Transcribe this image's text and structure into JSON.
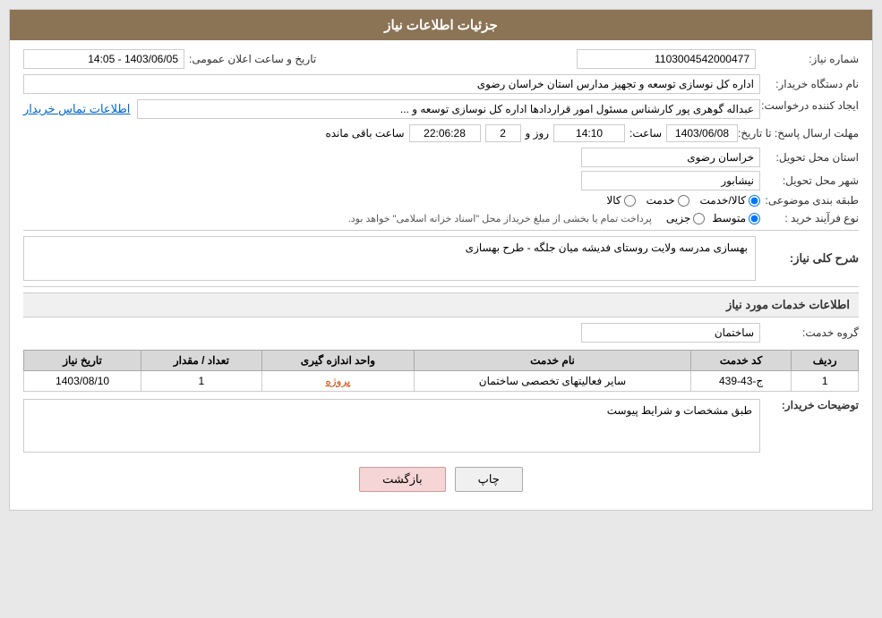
{
  "header": {
    "title": "جزئیات اطلاعات نیاز"
  },
  "fields": {
    "shomar_niaz_label": "شماره نیاز:",
    "shomar_niaz_value": "1103004542000477",
    "tarikh_label": "تاریخ و ساعت اعلان عمومی:",
    "tarikh_value": "1403/06/05 - 14:05",
    "nam_dastgah_label": "نام دستگاه خریدار:",
    "nam_dastgah_value": "اداره کل نوسازی  توسعه و تجهیز مدارس استان خراسان رضوی",
    "ejad_label": "ایجاد کننده درخواست:",
    "ejad_value": "عبداله گوهری پور کارشناس مسئول امور قراردادها  اداره کل نوسازی  توسعه و ...",
    "ejad_link": "اطلاعات تماس خریدار",
    "mohlat_label": "مهلت ارسال پاسخ: تا تاریخ:",
    "mohlat_date": "1403/06/08",
    "mohlat_saat_label": "ساعت:",
    "mohlat_saat_value": "14:10",
    "mohlat_roz_label": "روز و",
    "mohlat_roz_value": "2",
    "mohlat_countdown": "22:06:28",
    "mohlat_mande": "ساعت باقی مانده",
    "ostan_label": "استان محل تحویل:",
    "ostan_value": "خراسان رضوی",
    "shahr_label": "شهر محل تحویل:",
    "shahr_value": "نیشابور",
    "tabagheh_label": "طبقه بندی موضوعی:",
    "tabagheh_kala": "کالا",
    "tabagheh_khadamat": "خدمت",
    "tabagheh_kala_khadamat": "کالا/خدمت",
    "tabagheh_selected": "kala_khadamat",
    "noe_farayand_label": "نوع فرآیند خرید :",
    "noe_jozei": "جزیی",
    "noe_mottasat": "متوسط",
    "noe_desc": "پرداخت تمام یا بخشی از مبلغ خریداز محل \"اسناد خزانه اسلامی\" خواهد بود.",
    "noe_selected": "mottasat",
    "sharh_section_title": "شرح کلی نیاز:",
    "sharh_value": "بهسازی مدرسه ولایت روستای فدیشه میان جلگه - طرح بهسازی",
    "khadamat_section_title": "اطلاعات خدمات مورد نیاز",
    "gorooh_label": "گروه خدمت:",
    "gorooh_value": "ساختمان",
    "table_headers": [
      "ردیف",
      "کد خدمت",
      "نام خدمت",
      "واحد اندازه گیری",
      "تعداد / مقدار",
      "تاریخ نیاز"
    ],
    "table_rows": [
      {
        "radif": "1",
        "kod_khadamat": "ج-43-439",
        "nam_khadamat": "سایر فعالیتهای تخصصی ساختمان",
        "vahed": "پروژه",
        "tedad": "1",
        "tarikh_niaz": "1403/08/10"
      }
    ],
    "toseeh_label": "توضیحات خریدار:",
    "toseeh_value": "طبق مشخصات و شرایط پیوست",
    "btn_chap": "چاپ",
    "btn_bazgasht": "بازگشت"
  }
}
